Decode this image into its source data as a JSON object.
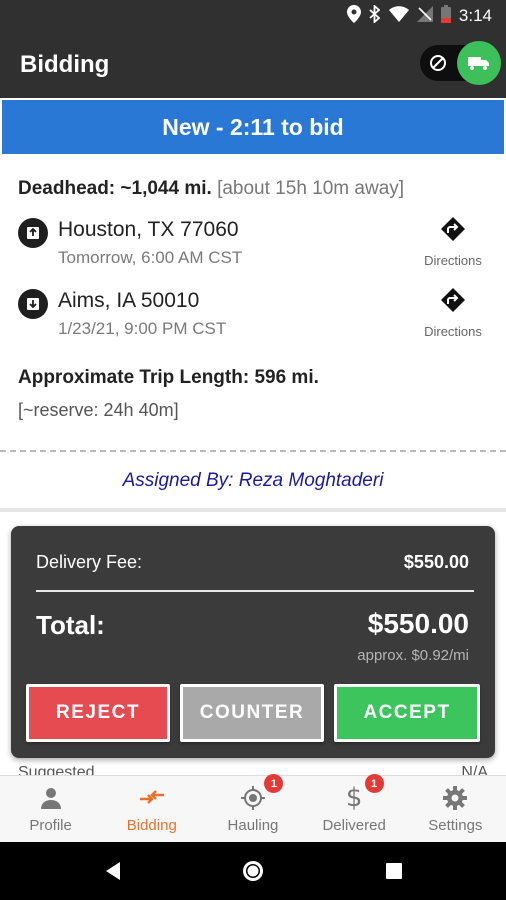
{
  "status_bar": {
    "time": "3:14"
  },
  "app_bar": {
    "title": "Bidding"
  },
  "banner": {
    "text": "New - 2:11 to bid"
  },
  "load": {
    "deadhead_label": "Deadhead:",
    "deadhead_distance": "~1,044 mi.",
    "deadhead_away": "[about 15h 10m away]",
    "pickup": {
      "city": "Houston, TX 77060",
      "time": "Tomorrow, 6:00 AM CST",
      "directions_label": "Directions"
    },
    "dropoff": {
      "city": "Aims, IA 50010",
      "time": "1/23/21, 9:00 PM CST",
      "directions_label": "Directions"
    },
    "trip_length": "Approximate Trip Length: 596 mi.",
    "reserve": "[~reserve: 24h 40m]",
    "assigned_by": "Assigned By: Reza Moghtaderi"
  },
  "fee_card": {
    "delivery_fee_label": "Delivery Fee:",
    "delivery_fee_value": "$550.00",
    "total_label": "Total:",
    "total_value": "$550.00",
    "per_mile": "approx. $0.92/mi",
    "reject_label": "REJECT",
    "counter_label": "COUNTER",
    "accept_label": "ACCEPT"
  },
  "peek_row": {
    "left": "Suggested",
    "right": "N/A"
  },
  "bottom_nav": {
    "items": [
      {
        "label": "Profile",
        "icon": "person-icon",
        "active": false
      },
      {
        "label": "Bidding",
        "icon": "bid-arrows-icon",
        "active": true
      },
      {
        "label": "Hauling",
        "icon": "location-target-icon",
        "badge": "1"
      },
      {
        "label": "Delivered",
        "icon": "dollar-icon",
        "badge": "1"
      },
      {
        "label": "Settings",
        "icon": "gear-icon"
      }
    ]
  },
  "colors": {
    "app_bar": "#303030",
    "banner": "#2a78d6",
    "accent_active": "#e2722e",
    "reject": "#e54b50",
    "counter": "#a9a9a9",
    "accept": "#3cc45d",
    "assigned_text": "#1a1a9e"
  }
}
